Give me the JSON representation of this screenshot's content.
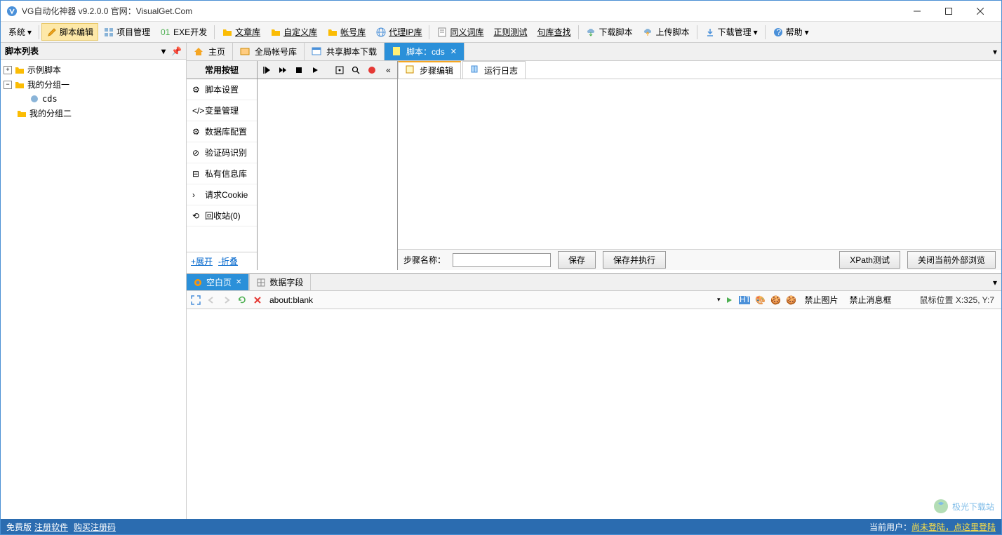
{
  "titlebar": {
    "title": "VG自动化神器 v9.2.0.0   官网：VisualGet.Com"
  },
  "toolbar": {
    "system": "系统",
    "script_edit": "脚本编辑",
    "project_mgmt": "项目管理",
    "exe_dev": "EXE开发",
    "article_lib": "文章库",
    "custom_lib": "自定义库",
    "account_lib": "帐号库",
    "proxy_lib": "代理IP库",
    "synonym_lib": "同义词库",
    "regex_test": "正则测试",
    "sentence_lookup": "句库查找",
    "download_script": "下载脚本",
    "upload_script": "上传脚本",
    "download_mgmt": "下载管理",
    "help": "帮助"
  },
  "left_panel": {
    "title": "脚本列表",
    "tree": {
      "example": "示例脚本",
      "group1": "我的分组一",
      "cds": "cds",
      "group2": "我的分组二"
    }
  },
  "doc_tabs": {
    "home": "主页",
    "global_accounts": "全局帐号库",
    "shared_download": "共享脚本下载",
    "script_cds": "脚本：cds"
  },
  "script_sidebar": {
    "head": "常用按钮",
    "script_settings": "脚本设置",
    "var_mgmt": "变量管理",
    "db_config": "数据库配置",
    "captcha": "验证码识别",
    "private_info": "私有信息库",
    "request_cookie": "请求Cookie",
    "recycle": "回收站(0)",
    "expand": "+展开",
    "collapse": "-折叠"
  },
  "sub_tabs": {
    "step_edit": "步骤编辑",
    "run_log": "运行日志"
  },
  "step_footer": {
    "label": "步骤名称：",
    "save": "保存",
    "save_exec": "保存并执行",
    "xpath": "XPath测试",
    "close_ext": "关闭当前外部浏览"
  },
  "browser_tabs": {
    "blank": "空白页",
    "data_fields": "数据字段"
  },
  "browser_bar": {
    "url": "about:blank",
    "disable_img": "禁止图片",
    "disable_msgbox": "禁止消息框",
    "mouse_pos": "鼠标位置 X:325, Y:7"
  },
  "watermark": "极光下载站",
  "statusbar": {
    "free": "免费版",
    "register": "注册软件",
    "buy": "购买注册码",
    "current_user": "当前用户：",
    "not_logged": "尚未登陆，点这里登陆"
  }
}
